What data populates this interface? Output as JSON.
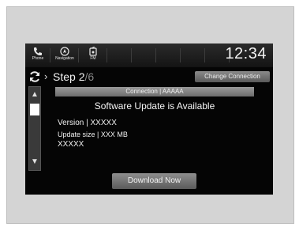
{
  "statusbar": {
    "phone_label": "Phone",
    "navigation_label": "Navigation",
    "fm_label": "FM",
    "clock": "12:34"
  },
  "step": {
    "prefix": "Step 2",
    "total": "/6",
    "change_connection": "Change Connection"
  },
  "content": {
    "connection": "Connection | AAAAA",
    "title": "Software Update is Available",
    "version": "Version | XXXXX",
    "update_size": "Update size | XXX MB",
    "extra": "XXXXX",
    "download_button": "Download Now"
  },
  "scroll": {
    "up_icon": "scroll-up-icon",
    "down_icon": "scroll-down-icon"
  }
}
